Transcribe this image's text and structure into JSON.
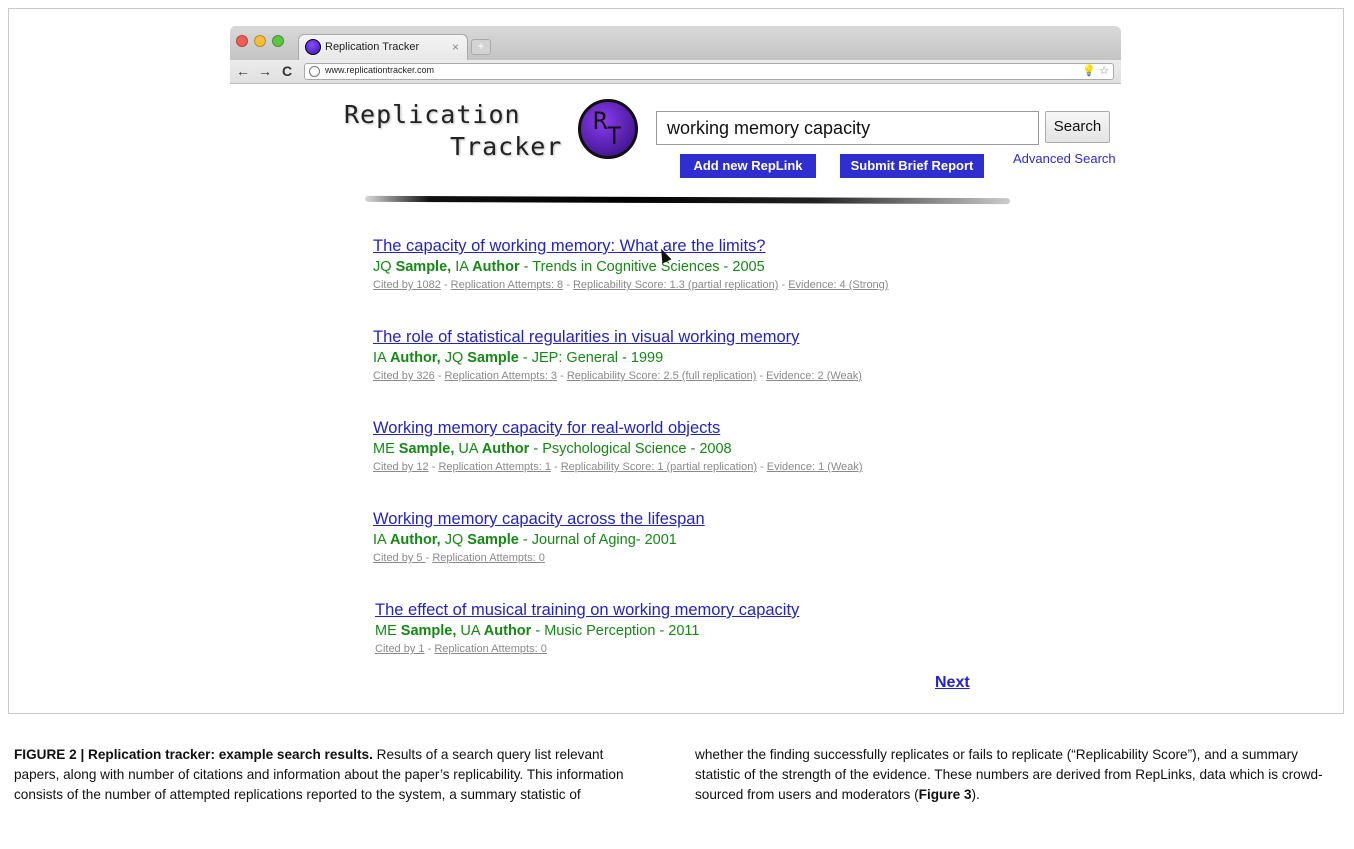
{
  "browser": {
    "tab_title": "Replication Tracker",
    "tab_close": "×",
    "newtab_symbol": "+",
    "url": "www.replicationtracker.com",
    "back": "←",
    "forward": "→",
    "reload": "C",
    "omnibox_icons": "💡 ☆"
  },
  "logo": {
    "line1": "Replication",
    "line2": "Tracker",
    "badge_r": "R",
    "badge_t": "T"
  },
  "search": {
    "query": "working memory capacity",
    "button": "Search",
    "add_replink": "Add new RepLink",
    "submit_report": "Submit Brief Report",
    "advanced": "Advanced Search"
  },
  "results": [
    {
      "title": "The capacity of working memory: What are the limits?",
      "authors": [
        {
          "initials": "JQ",
          "name": "Sample,"
        },
        {
          "initials": "IA",
          "name": "Author"
        }
      ],
      "venue": " - Trends in Cognitive Sciences - 2005",
      "meta": [
        {
          "text": "Cited by 1082",
          "sep": " - "
        },
        {
          "text": "Replication Attempts: 8",
          "sep": " - "
        },
        {
          "text": "Replicability Score: 1.3 (partial replication)",
          "sep": "  - "
        },
        {
          "text": "Evidence: 4 (Strong)",
          "sep": ""
        }
      ]
    },
    {
      "title": "The role of statistical regularities in visual working memory",
      "authors": [
        {
          "initials": "IA",
          "name": "Author,"
        },
        {
          "initials": "JQ",
          "name": "Sample"
        }
      ],
      "venue": " - JEP: General - 1999",
      "meta": [
        {
          "text": "Cited by 326",
          "sep": " - "
        },
        {
          "text": "Replication Attempts: 3",
          "sep": " - "
        },
        {
          "text": "Replicability Score: 2.5 (full replication)",
          "sep": "  - "
        },
        {
          "text": "Evidence: 2 (Weak)",
          "sep": ""
        }
      ]
    },
    {
      "title": "Working memory capacity for real-world objects",
      "authors": [
        {
          "initials": "ME",
          "name": "Sample,"
        },
        {
          "initials": "UA",
          "name": "Author"
        }
      ],
      "venue": "  - Psychological Science - 2008",
      "meta": [
        {
          "text": "Cited by 12",
          "sep": " - "
        },
        {
          "text": "Replication Attempts: 1",
          "sep": " - "
        },
        {
          "text": "Replicability Score: 1 (partial replication)",
          "sep": "  - "
        },
        {
          "text": "Evidence: 1 (Weak)",
          "sep": ""
        }
      ]
    },
    {
      "title": "Working memory capacity across the lifespan",
      "authors": [
        {
          "initials": "IA",
          "name": "Author,"
        },
        {
          "initials": "JQ",
          "name": "Sample"
        }
      ],
      "venue": " - Journal of Aging- 2001",
      "meta": [
        {
          "text": "Cited by 5 ",
          "sep": "- "
        },
        {
          "text": "Replication Attempts: 0",
          "sep": ""
        }
      ]
    },
    {
      "title": "The effect of musical training on working memory capacity",
      "authors": [
        {
          "initials": "ME",
          "name": "Sample,"
        },
        {
          "initials": "UA",
          "name": "Author"
        }
      ],
      "venue": "  - Music Perception - 2011",
      "meta": [
        {
          "text": "Cited by 1",
          "sep": " - "
        },
        {
          "text": "Replication Attempts: 0",
          "sep": ""
        }
      ]
    }
  ],
  "next": "Next",
  "caption": {
    "label": "FIGURE 2 | Replication tracker: example search results.",
    "left_text": " Results of a search query list relevant papers, along with number of citations and information about the paper’s replicability. This information consists of the number of attempted replications reported to the system, a summary statistic of",
    "right_text": "whether the finding successfully replicates or fails to replicate (“Replicability Score”), and a summary statistic of the strength of the evidence. These numbers are derived from RepLinks, data which is crowd-sourced from users and moderators (",
    "right_bold": "Figure 3",
    "right_end": ")."
  }
}
